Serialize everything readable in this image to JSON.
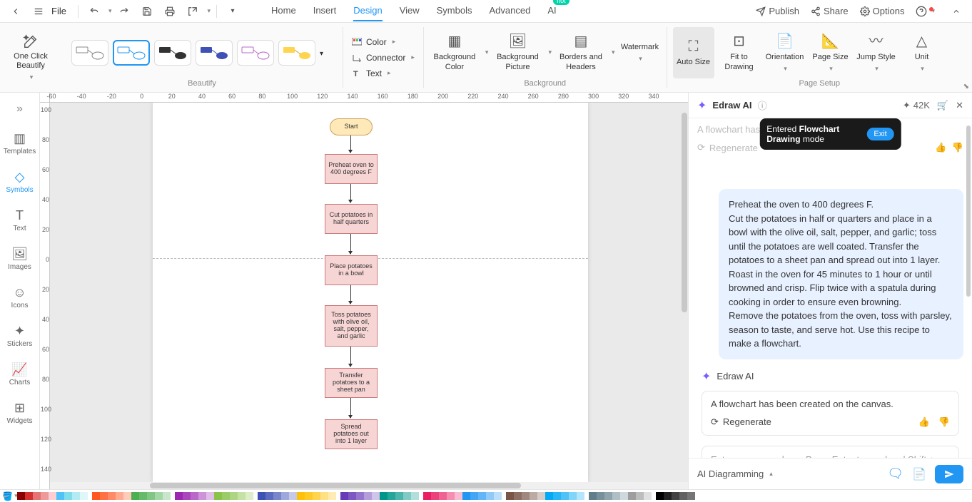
{
  "topbar": {
    "file_label": "File",
    "tabs": [
      "Home",
      "Insert",
      "Design",
      "View",
      "Symbols",
      "Advanced",
      "AI"
    ],
    "active_tab": "Design",
    "hot_badge": "hot",
    "right": {
      "publish": "Publish",
      "share": "Share",
      "options": "Options"
    }
  },
  "ribbon": {
    "one_click": "One Click Beautify",
    "beautify_label": "Beautify",
    "color": "Color",
    "connector": "Connector",
    "text": "Text",
    "background_color": "Background Color",
    "background_picture": "Background Picture",
    "borders_headers": "Borders and Headers",
    "watermark": "Watermark",
    "background_label": "Background",
    "auto_size": "Auto Size",
    "fit_drawing": "Fit to Drawing",
    "orientation": "Orientation",
    "page_size": "Page Size",
    "jump_style": "Jump Style",
    "unit": "Unit",
    "page_setup_label": "Page Setup"
  },
  "sidebar": {
    "items": [
      {
        "label": "Templates"
      },
      {
        "label": "Symbols"
      },
      {
        "label": "Text"
      },
      {
        "label": "Images"
      },
      {
        "label": "Icons"
      },
      {
        "label": "Stickers"
      },
      {
        "label": "Charts"
      },
      {
        "label": "Widgets"
      }
    ]
  },
  "ruler_h": [
    "-60",
    "-40",
    "-20",
    "0",
    "20",
    "40",
    "60",
    "80",
    "100",
    "120",
    "140",
    "160",
    "180",
    "200",
    "220",
    "240",
    "260",
    "280",
    "300",
    "320",
    "340"
  ],
  "ruler_v": [
    "100",
    "80",
    "60",
    "40",
    "20",
    "0",
    "20",
    "40",
    "60",
    "80",
    "100",
    "120",
    "140"
  ],
  "flowchart": {
    "start": "Start",
    "n1": "Preheat oven to 400 degrees F",
    "n2": "Cut potatoes in half quarters",
    "n3": "Place potatoes in a bowl",
    "n4": "Toss potatoes with olive oil, salt, pepper, and garlic",
    "n5": "Transfer potatoes to a sheet pan",
    "n6": "Spread potatoes out into 1 layer"
  },
  "ai": {
    "title": "Edraw AI",
    "tokens": "42K",
    "prev_created": "A flowchart has been created on the canvas.",
    "regenerate": "Regenerate",
    "mode_prefix": "Entered ",
    "mode_name": "Flowchart Drawing",
    "mode_suffix": " mode",
    "exit": "Exit",
    "user_msg": "Preheat the oven to 400 degrees F.\nCut the potatoes in half or quarters and place in a bowl with the olive oil, salt, pepper, and garlic; toss until the potatoes are well coated. Transfer the potatoes to a sheet pan and spread out into 1 layer. Roast in the oven for 45 minutes to 1 hour or until browned and crisp. Flip twice with a spatula during cooking in order to ensure even browning.\nRemove the potatoes from the oven, toss with parsley, season to taste, and serve hot. Use this recipe to make a flowchart.",
    "bot_name": "Edraw AI",
    "response": "A flowchart has been created on the canvas.",
    "input_placeholder": "Enter your query here. Press Enter to send and Shift + Enter to start a new line.",
    "mode_select": "AI Diagramming"
  },
  "colors": {
    "row1": [
      "#8b0000",
      "#d32f2f",
      "#e57373",
      "#ef9a9a",
      "#ffcdd2",
      "#4fc3f7",
      "#80deea",
      "#b2ebf2",
      "#e0f7fa"
    ],
    "row2": [
      "#ff5722",
      "#ff7043",
      "#ff8a65",
      "#ffab91",
      "#ffccbc",
      "#4caf50",
      "#66bb6a",
      "#81c784",
      "#a5d6a7",
      "#c8e6c9"
    ],
    "row3": [
      "#9c27b0",
      "#ab47bc",
      "#ba68c8",
      "#ce93d8",
      "#e1bee7",
      "#8bc34a",
      "#9ccc65",
      "#aed581",
      "#c5e1a5",
      "#dcedc8"
    ],
    "row4": [
      "#3f51b5",
      "#5c6bc0",
      "#7986cb",
      "#9fa8da",
      "#c5cae9",
      "#ffc107",
      "#ffca28",
      "#ffd54f",
      "#ffe082",
      "#ffecb3"
    ],
    "row5": [
      "#673ab7",
      "#7e57c2",
      "#9575cd",
      "#b39ddb",
      "#d1c4e9",
      "#009688",
      "#26a69a",
      "#4db6ac",
      "#80cbc4",
      "#b2dfdb"
    ],
    "row6": [
      "#e91e63",
      "#ec407a",
      "#f06292",
      "#f48fb1",
      "#f8bbd0",
      "#2196f3",
      "#42a5f5",
      "#64b5f6",
      "#90caf9",
      "#bbdefb"
    ],
    "row7": [
      "#795548",
      "#8d6e63",
      "#a1887f",
      "#bcaaa4",
      "#d7ccc8",
      "#03a9f4",
      "#29b6f6",
      "#4fc3f7",
      "#81d4fa",
      "#b3e5fc"
    ],
    "row8": [
      "#607d8b",
      "#78909c",
      "#90a4ae",
      "#b0bec5",
      "#cfd8dc",
      "#9e9e9e",
      "#bdbdbd",
      "#e0e0e0"
    ],
    "grays": [
      "#000000",
      "#212121",
      "#424242",
      "#616161",
      "#757575"
    ]
  }
}
